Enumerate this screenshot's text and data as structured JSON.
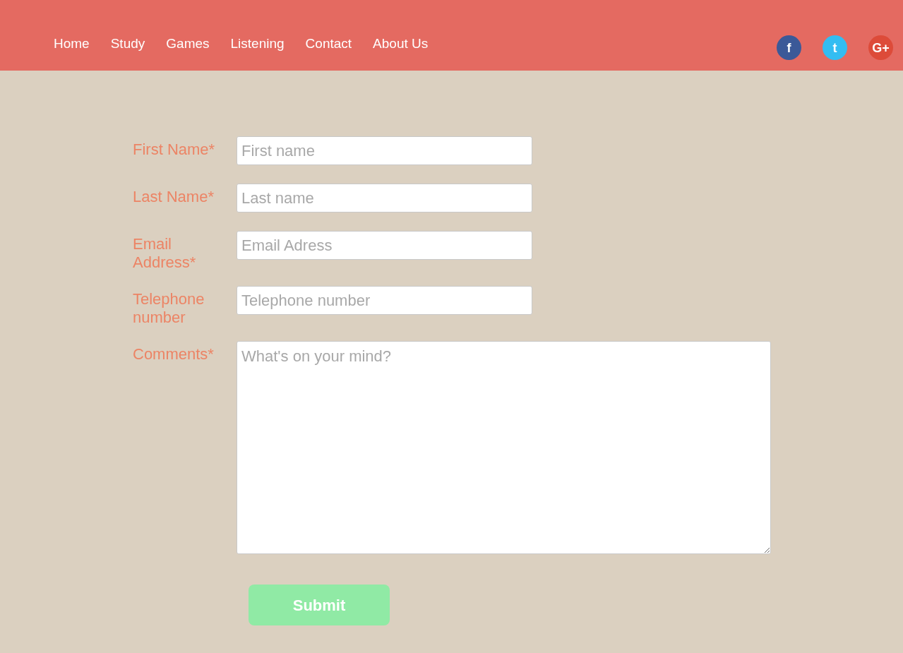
{
  "nav": [
    "Home",
    "Study",
    "Games",
    "Listening",
    "Contact",
    "About Us"
  ],
  "social": [
    {
      "glyph": "f",
      "color": "#3b5998"
    },
    {
      "glyph": "t",
      "color": "#33bdf2"
    },
    {
      "glyph": "G+",
      "color": "#dd4b39"
    }
  ],
  "form": {
    "fields": [
      {
        "kind": "input",
        "label": "First Name*",
        "placeholder": "First name"
      },
      {
        "kind": "input",
        "label": "Last Name*",
        "placeholder": "Last name"
      },
      {
        "kind": "input",
        "label": "Email Address*",
        "placeholder": "Email Adress"
      },
      {
        "kind": "input",
        "label": "Telephone number",
        "placeholder": "Telephone number"
      },
      {
        "kind": "textarea",
        "label": "Comments*",
        "placeholder": "What's on your mind?"
      }
    ],
    "submit": "Submit"
  }
}
